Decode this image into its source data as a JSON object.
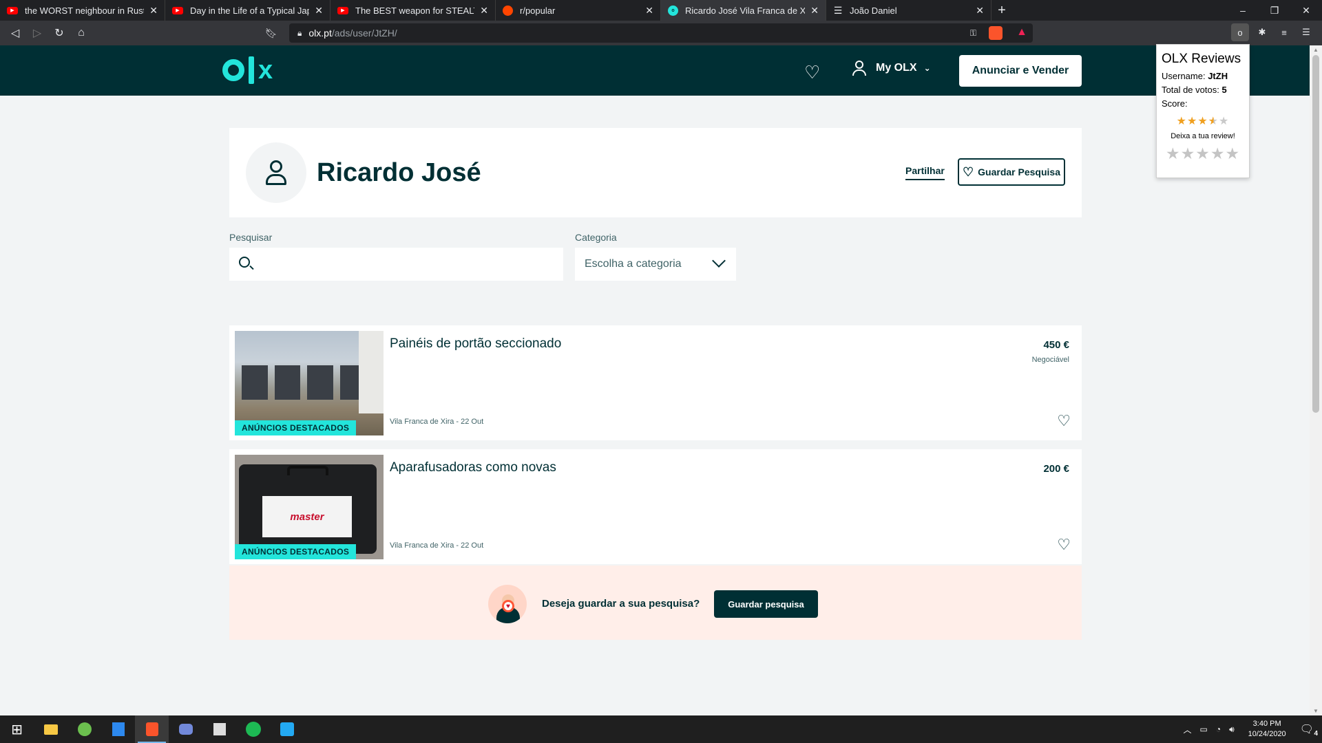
{
  "browser": {
    "tabs": [
      {
        "title": "the WORST neighbour in Rust. - Yo",
        "icon": "youtube-icon"
      },
      {
        "title": "Day in the Life of a Typical Japanes",
        "icon": "youtube-icon"
      },
      {
        "title": "The BEST weapon for STEALTHY pl",
        "icon": "youtube-icon"
      },
      {
        "title": "r/popular",
        "icon": "reddit-icon"
      },
      {
        "title": "Ricardo José Vila Franca de Xira - /",
        "icon": "olx-icon"
      },
      {
        "title": "João Daniel",
        "icon": "document-icon"
      }
    ],
    "url_domain": "olx.pt",
    "url_path": "/ads/user/JtZH/"
  },
  "header": {
    "logo": "olx",
    "myolx_label": "My OLX",
    "sell_button": "Anunciar e Vender"
  },
  "profile": {
    "name": "Ricardo José",
    "share_label": "Partilhar",
    "save_search_label": "Guardar Pesquisa"
  },
  "filters": {
    "search_label": "Pesquisar",
    "search_value": "",
    "category_label": "Categoria",
    "category_value": "Escolha a categoria"
  },
  "listings": [
    {
      "title": "Painéis de portão seccionado",
      "price": "450 €",
      "negotiable": "Negociável",
      "meta": "Vila Franca de Xira - 22 Out",
      "badge": "ANÚNCIOS DESTACADOS"
    },
    {
      "title": "Aparafusadoras como novas",
      "price": "200 €",
      "negotiable": "",
      "meta": "Vila Franca de Xira - 22 Out",
      "badge": "ANÚNCIOS DESTACADOS",
      "thumb_text": "master"
    }
  ],
  "banner": {
    "text": "Deseja guardar a sua pesquisa?",
    "button": "Guardar pesquisa"
  },
  "reviews": {
    "title": "OLX Reviews",
    "username_label": "Username:",
    "username": "JtZH",
    "votes_label": "Total de votos:",
    "votes": "5",
    "score_label": "Score:",
    "score_stars": 3.5,
    "cta": "Deixa a tua review!"
  },
  "taskbar": {
    "time": "3:40 PM",
    "date": "10/24/2020",
    "notifications": "4"
  },
  "colors": {
    "olx_dark": "#002f34",
    "olx_teal": "#23e5db",
    "banner_bg": "#ffeee9"
  }
}
